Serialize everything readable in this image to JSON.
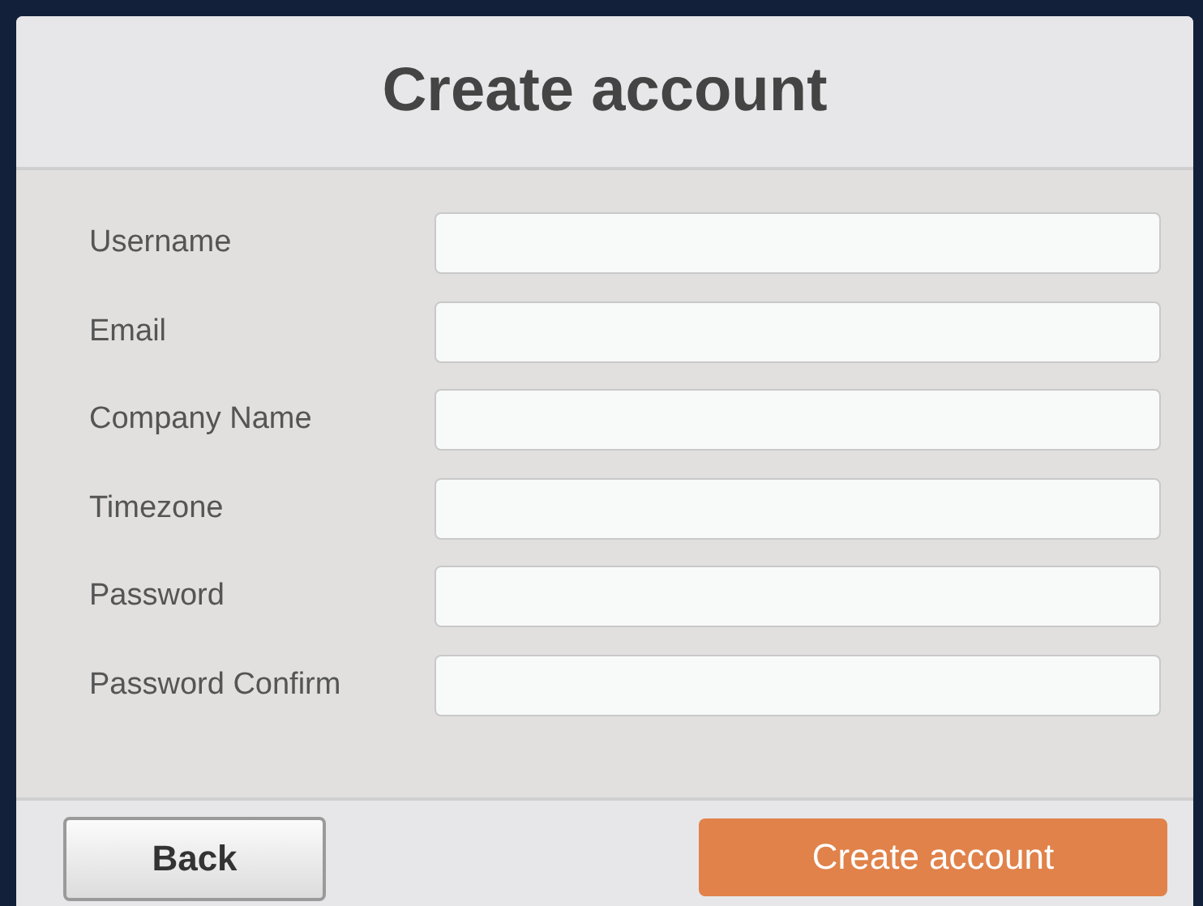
{
  "title": "Create account",
  "fields": [
    {
      "label": "Username"
    },
    {
      "label": "Email"
    },
    {
      "label": "Company Name"
    },
    {
      "label": "Timezone"
    },
    {
      "label": "Password"
    },
    {
      "label": "Password Confirm"
    }
  ],
  "buttons": [
    {
      "label": "Back",
      "kind": "secondary"
    },
    {
      "label": "Create account",
      "kind": "primary"
    }
  ]
}
